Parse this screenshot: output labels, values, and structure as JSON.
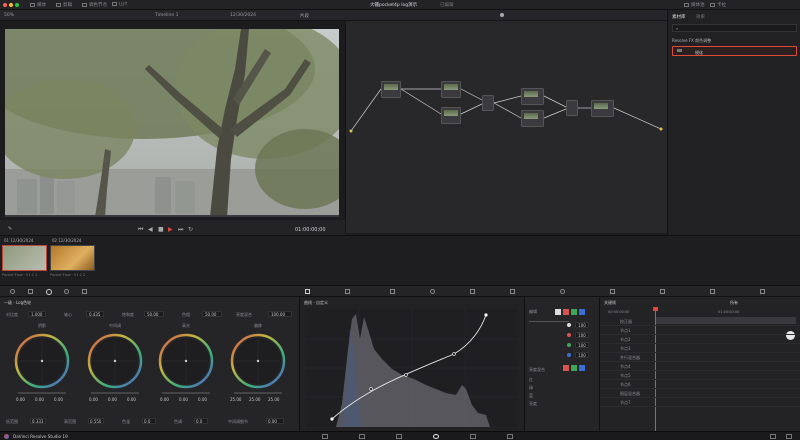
{
  "colors": {
    "accent_red": "#e04a3a",
    "curve_white": "#e8e8e8",
    "panel_bg": "#252528",
    "highlight_orange": "#d9534f"
  },
  "topbar": {
    "items": [
      "媒体",
      "剪辑",
      "调色节点",
      "LUT",
      "卡拉"
    ],
    "project_title": "大疆pocket4p log演示",
    "project_status": "已编辑",
    "right_items": [
      "媒体池"
    ]
  },
  "secondbar": {
    "zoom": "50%",
    "timeline": "Timeline 1",
    "date": "12/30/2024",
    "extra": "片段"
  },
  "viewer": {
    "timecode": "01:00:00;00"
  },
  "right_panel": {
    "tabs": [
      "素材库",
      "效果"
    ],
    "search_placeholder": "搜索",
    "category": "Resolve FX 颜色调整",
    "selected_item": "锐化"
  },
  "clips": [
    {
      "number": "01",
      "date": "12/30/2024",
      "label": "Pocket Flow · V1 2 1"
    },
    {
      "number": "02",
      "date": "12/30/2024",
      "label": "Pocket Flow · V1 2 2"
    }
  ],
  "wheels": {
    "mode_label": "一级 - Log色轮",
    "top_params": [
      {
        "label": "对比度",
        "value": "1.000"
      },
      {
        "label": "轴心",
        "value": "0.435"
      },
      {
        "label": "饱和度",
        "value": "50.00"
      },
      {
        "label": "色相",
        "value": "50.00"
      },
      {
        "label": "亮度混合",
        "value": "100.00"
      }
    ],
    "items": [
      {
        "name": "阴影",
        "vals": [
          "0.00",
          "0.00",
          "0.00"
        ]
      },
      {
        "name": "中间调",
        "vals": [
          "0.00",
          "0.00",
          "0.00"
        ]
      },
      {
        "name": "高光",
        "vals": [
          "0.00",
          "0.00",
          "0.00"
        ]
      },
      {
        "name": "偏移",
        "vals": [
          "25.00",
          "25.00",
          "25.00"
        ]
      }
    ],
    "bottom_params": [
      {
        "label": "低范围",
        "value": "0.333"
      },
      {
        "label": "高范围",
        "value": "0.550"
      },
      {
        "label": "色温",
        "value": "0.0"
      },
      {
        "label": "色调",
        "value": "0.0"
      },
      {
        "label": "中间调细节",
        "value": "0.00"
      }
    ]
  },
  "curves": {
    "title": "曲线 - 自定义"
  },
  "channels": {
    "labels": [
      "编辑",
      "亮度混合"
    ],
    "values": [
      "100",
      "100",
      "100",
      "100"
    ],
    "rows": [
      "红",
      "绿",
      "蓝",
      "亮度"
    ]
  },
  "keyframes": {
    "title": "关键帧",
    "filter": "所有",
    "timecode_a": "00:00:00:00",
    "timecode_b": "01:00:00:00",
    "rows": [
      "校正器",
      "节点1",
      "节点2",
      "节点3",
      "并行混合器",
      "节点4",
      "节点5",
      "节点6",
      "图层混合器",
      "节点7"
    ]
  },
  "bottombar": {
    "app_name": "DaVinci Resolve Studio 19"
  }
}
